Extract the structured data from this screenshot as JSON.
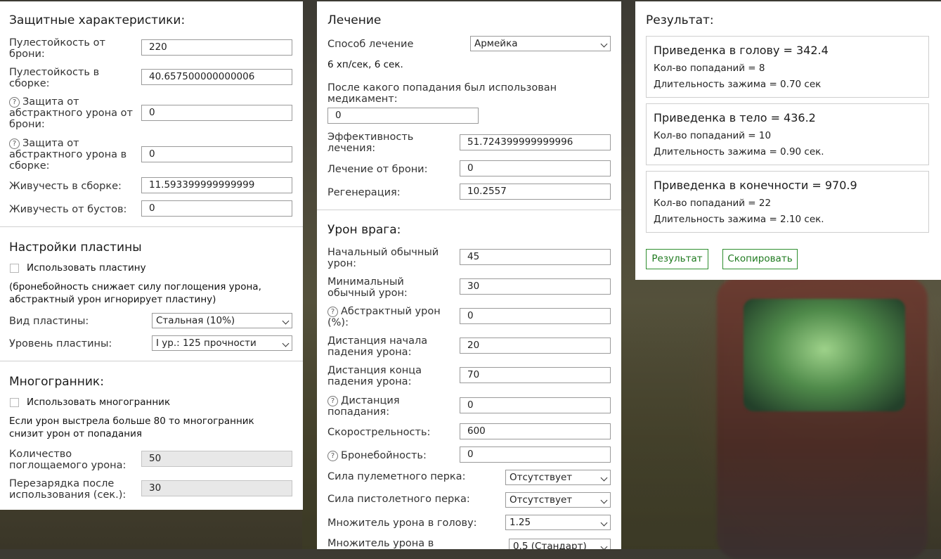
{
  "protection": {
    "title": "Защитные характеристики:",
    "armor_bullet_res": {
      "label": "Пулестойкость от брони:",
      "value": "220"
    },
    "build_bullet_res": {
      "label": "Пулестойкость в сборке:",
      "value": "40.657500000000006"
    },
    "armor_abstract": {
      "label": "Защита от абстрактного урона от брони:",
      "value": "0"
    },
    "build_abstract": {
      "label": "Защита от абстрактного урона в сборке:",
      "value": "0"
    },
    "build_vitality": {
      "label": "Живучесть в сборке:",
      "value": "11.593399999999999"
    },
    "boost_vitality": {
      "label": "Живучесть от бустов:",
      "value": "0"
    }
  },
  "plate": {
    "title": "Настройки пластины",
    "use_label": "Использовать пластину",
    "note": "(бронебойность снижает силу поглощения урона, абстрактный урон игнорирует пластину)",
    "type": {
      "label": "Вид пластины:",
      "selected": "Стальная (10%)"
    },
    "level": {
      "label": "Уровень пластины:",
      "selected": "I ур.: 125 прочности"
    }
  },
  "polyhedron": {
    "title": "Многогранник:",
    "use_label": "Использовать многогранник",
    "note": "Если урон выстрела больше 80 то многогранник снизит урон от попадания",
    "absorbed": {
      "label": "Количество поглощаемого урона:",
      "value": "50"
    },
    "cooldown": {
      "label": "Перезарядка после использования (сек.):",
      "value": "30"
    }
  },
  "healing": {
    "title": "Лечение",
    "method": {
      "label": "Способ лечение",
      "selected": "Армейка"
    },
    "rate_text": "6 хп/сек, 6 сек.",
    "after_hit": {
      "label": "После какого попадания был использован медикамент:",
      "value": "0"
    },
    "efficiency": {
      "label": "Эффективность лечения:",
      "value": "51.724399999999996"
    },
    "armor_heal": {
      "label": "Лечение от брони:",
      "value": "0"
    },
    "regen": {
      "label": "Регенерация:",
      "value": "10.2557"
    }
  },
  "enemy": {
    "title": "Урон врага:",
    "start_dmg": {
      "label": "Начальный обычный урон:",
      "value": "45"
    },
    "min_dmg": {
      "label": "Минимальный обычный урон:",
      "value": "30"
    },
    "abstract_dmg": {
      "label": "Абстрактный урон (%):",
      "value": "0"
    },
    "falloff_start": {
      "label": "Дистанция начала падения урона:",
      "value": "20"
    },
    "falloff_end": {
      "label": "Дистанция конца падения урона:",
      "value": "70"
    },
    "hit_distance": {
      "label": "Дистанция попадания:",
      "value": "0"
    },
    "fire_rate": {
      "label": "Скорострельность:",
      "value": "600"
    },
    "armor_pen": {
      "label": "Бронебойность:",
      "value": "0"
    },
    "mg_perk": {
      "label": "Сила пулеметного перка:",
      "selected": "Отсутствует"
    },
    "pistol_perk": {
      "label": "Сила пистолетного перка:",
      "selected": "Отсутствует"
    },
    "head_mult": {
      "label": "Множитель урона в голову:",
      "selected": "1.25"
    },
    "body_mult": {
      "label": "Множитель урона в",
      "selected": "0.5 (Стандарт)"
    }
  },
  "result": {
    "title": "Результат:",
    "cards": [
      {
        "heading": "Приведенка в голову = 342.4",
        "hits": "Кол-во попаданий = 8",
        "hold": "Длительность зажима = 0.70 сек"
      },
      {
        "heading": "Приведенка в тело = 436.2",
        "hits": "Кол-во попаданий = 10",
        "hold": "Длительность зажима = 0.90 сек."
      },
      {
        "heading": "Приведенка в конечности = 970.9",
        "hits": "Кол-во попаданий = 22",
        "hold": "Длительность зажима = 2.10 сек."
      }
    ],
    "btn_result": "Результат",
    "btn_copy": "Скопировать"
  },
  "colors": {
    "accent_green": "#1f7a1f"
  }
}
